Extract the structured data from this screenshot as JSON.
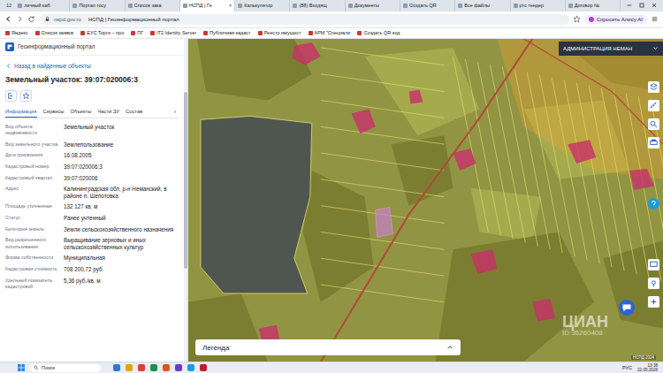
{
  "browser": {
    "tab_count": "12",
    "tab_close": "×",
    "tabs": [
      {
        "label": "личный каб",
        "selected": false
      },
      {
        "label": "Портал госу",
        "selected": false
      },
      {
        "label": "Список зака",
        "selected": false
      },
      {
        "label": "НСПД | Ге",
        "selected": true
      },
      {
        "label": "Калькулятор",
        "selected": false
      },
      {
        "label": "(88) Входящ",
        "selected": false
      },
      {
        "label": "Документы",
        "selected": false
      },
      {
        "label": "Создать QR",
        "selected": false
      },
      {
        "label": "Все файлы",
        "selected": false
      },
      {
        "label": "ртс тендер",
        "selected": false
      },
      {
        "label": "Договор №",
        "selected": false
      }
    ],
    "address": "nspd.gov.ru",
    "page_title": "НСПД | Геоинформационный портал",
    "alice": "Спросить Алису AI",
    "bookmarks": [
      "Яндекс",
      "Список заявок",
      "ЕУС Торги – про",
      "ПГ",
      "IT2 Identity Server",
      "Публичная кадаст",
      "Реестр имущест",
      "АРМ \"Специали",
      "Создать QR-код"
    ]
  },
  "portal": {
    "title": "Геоинформационный портал",
    "back": "Назад в найденные объекты",
    "object_title": "Земельный участок: 39:07:020006:3",
    "tabs": [
      {
        "label": "Информация",
        "selected": true
      },
      {
        "label": "Сервисы",
        "selected": false
      },
      {
        "label": "Объекты",
        "selected": false
      },
      {
        "label": "Части ЗУ",
        "selected": false
      },
      {
        "label": "Состав",
        "selected": false
      }
    ],
    "tabs_more": "›",
    "fields": [
      {
        "label": "Вид объекта недвижимости",
        "value": "Земельный участок"
      },
      {
        "label": "Вид земельного участка",
        "value": "Землепользование"
      },
      {
        "label": "Дата присвоения",
        "value": "16.08.2005"
      },
      {
        "label": "Кадастровый номер",
        "value": "39:07:020006:3"
      },
      {
        "label": "Кадастровый квартал",
        "value": "39:07:020006"
      },
      {
        "label": "Адрес",
        "value": "Калининградская обл, р-н Неманский, в районе п. Шепотовка"
      },
      {
        "label": "Площадь уточненная",
        "value": "132 127 кв. м"
      },
      {
        "label": "Статус",
        "value": "Ранее учтенный"
      },
      {
        "label": "Категория земель",
        "value": "Земли сельскохозяйственного назначения"
      },
      {
        "label": "Вид разрешенного использования",
        "value": "Выращивание зерновых и иных сельскохозяйственных культур"
      },
      {
        "label": "Форма собственности",
        "value": "Муниципальная"
      },
      {
        "label": "Кадастровая стоимость",
        "value": "708 200,72 руб."
      },
      {
        "label": "Удельный показатель кадастровой",
        "value": "5,36 руб./кв. м"
      }
    ]
  },
  "map": {
    "admin": "АДМИНИСТРАЦИЯ НЕМАН",
    "legend": "Легенда",
    "watermark": "ЦИАН",
    "watermark_id": "ID 36260408",
    "credit": "НСПД 2024"
  },
  "taskbar": {
    "search": "Поиск",
    "lang": "РУС",
    "time": "13:38",
    "date": "22.05.2026"
  }
}
